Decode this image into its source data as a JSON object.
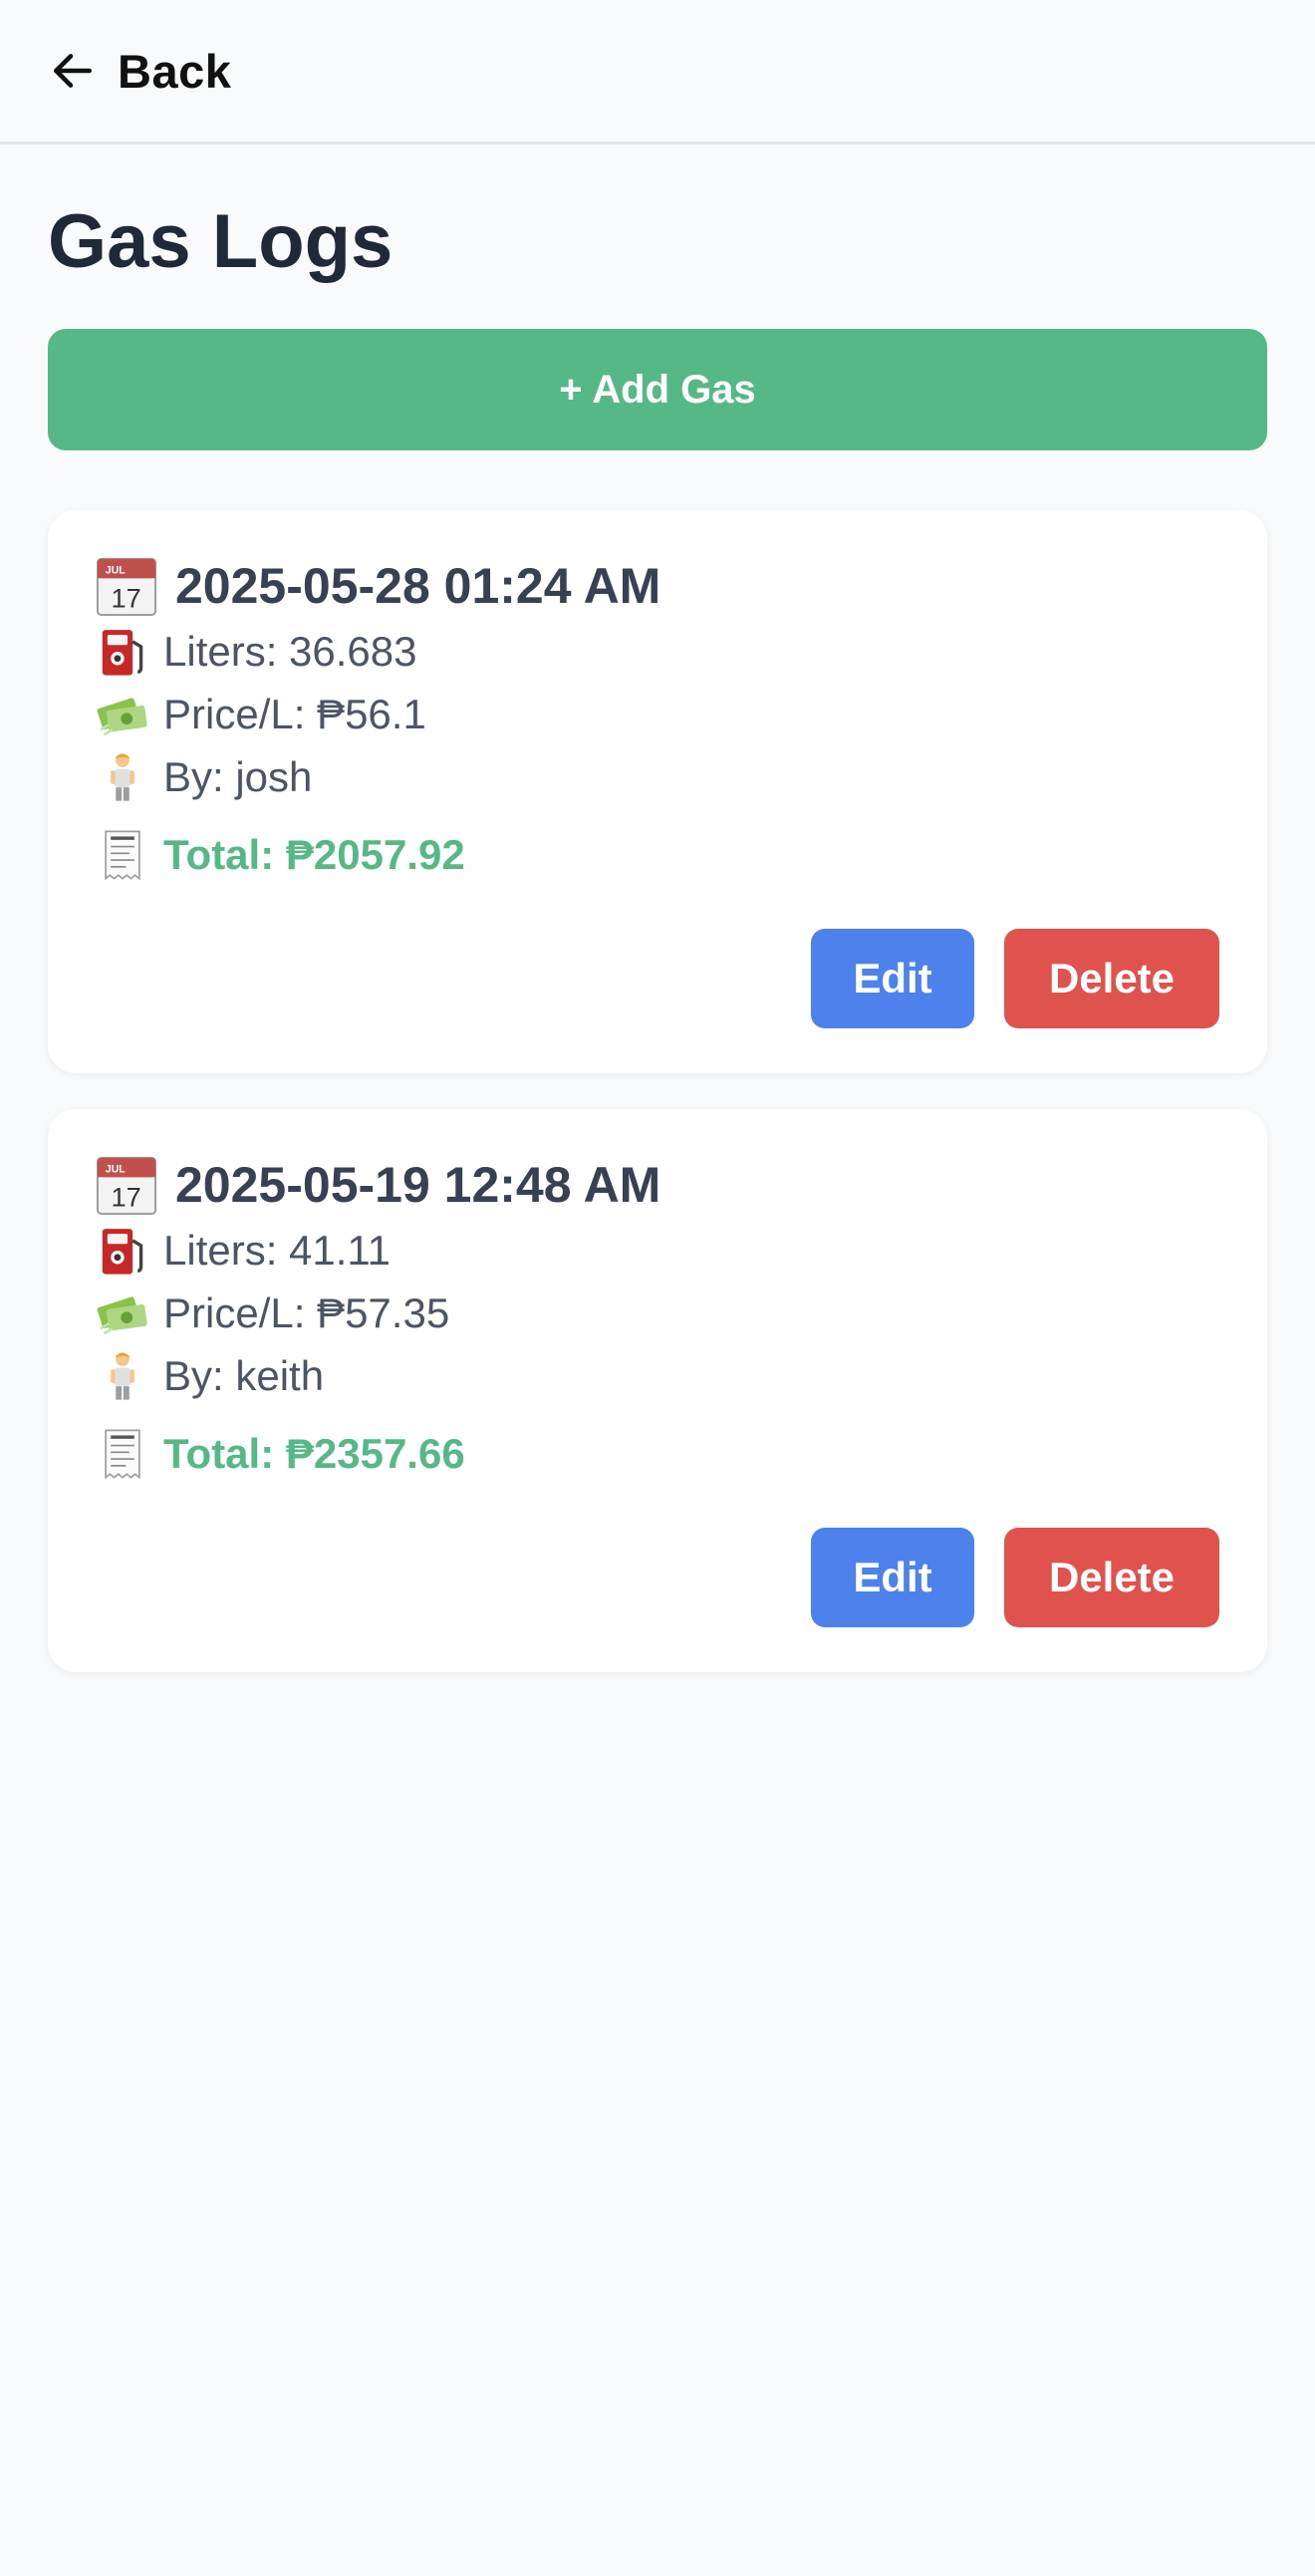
{
  "header": {
    "back_label": "Back"
  },
  "page": {
    "title": "Gas Logs",
    "add_button_label": "+ Add Gas"
  },
  "logs": [
    {
      "datetime": "2025-05-28 01:24 AM",
      "liters": "Liters: 36.683",
      "price": "Price/L: ₱56.1",
      "by": "By: josh",
      "total": "Total: ₱2057.92",
      "edit_label": "Edit",
      "delete_label": "Delete"
    },
    {
      "datetime": "2025-05-19 12:48 AM",
      "liters": "Liters: 41.11",
      "price": "Price/L: ₱57.35",
      "by": "By: keith",
      "total": "Total: ₱2357.66",
      "edit_label": "Edit",
      "delete_label": "Delete"
    }
  ],
  "icons": {
    "back": "arrow-left-icon",
    "date": "calendar-icon",
    "liters": "fuel-pump-icon",
    "price": "money-icon",
    "by": "person-icon",
    "total": "receipt-icon"
  },
  "colors": {
    "add_button": "#55b886",
    "total_text": "#55b886",
    "edit_button": "#4d82ec",
    "delete_button": "#df524e",
    "background": "#f9fafb"
  }
}
